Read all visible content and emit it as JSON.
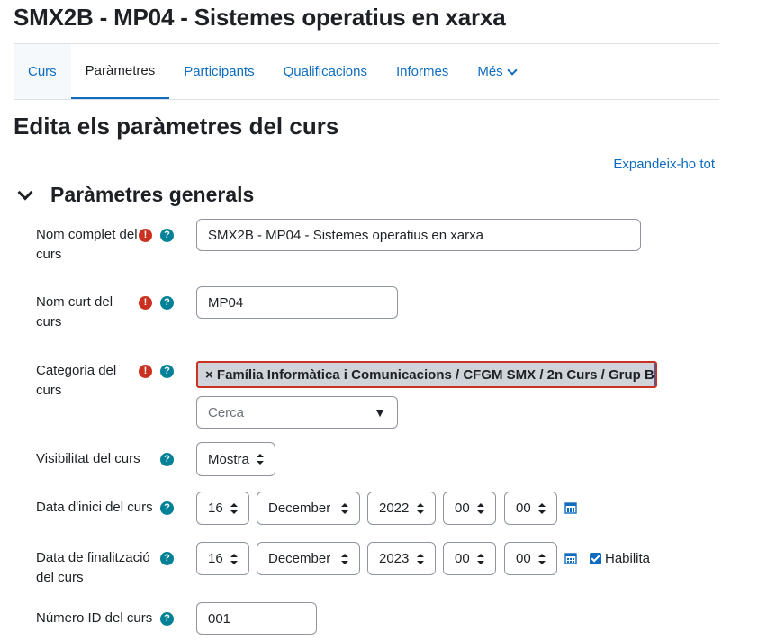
{
  "header": {
    "title": "SMX2B - MP04 - Sistemes operatius en xarxa"
  },
  "tabs": [
    {
      "label": "Curs"
    },
    {
      "label": "Paràmetres"
    },
    {
      "label": "Participants"
    },
    {
      "label": "Qualificacions"
    },
    {
      "label": "Informes"
    },
    {
      "label": "Més"
    }
  ],
  "page": {
    "heading": "Edita els paràmetres del curs",
    "expand_all": "Expandeix-ho tot",
    "section": "Paràmetres generals"
  },
  "form": {
    "fullname": {
      "label": "Nom complet del curs",
      "value": "SMX2B - MP04 - Sistemes operatius en xarxa"
    },
    "shortname": {
      "label": "Nom curt del curs",
      "value": "MP04"
    },
    "category": {
      "label": "Categoria del curs",
      "selected": "× Família Informàtica i Comunicacions / CFGM SMX / 2n Curs / Grup B",
      "search_placeholder": "Cerca"
    },
    "visibility": {
      "label": "Visibilitat del curs",
      "value": "Mostra"
    },
    "startdate": {
      "label": "Data d'inici del curs",
      "day": "16",
      "month": "December",
      "year": "2022",
      "hour": "00",
      "minute": "00"
    },
    "enddate": {
      "label": "Data de finalització del curs",
      "day": "16",
      "month": "December",
      "year": "2023",
      "hour": "00",
      "minute": "00",
      "enable_label": "Habilita"
    },
    "idnumber": {
      "label": "Número ID del curs",
      "value": "001"
    }
  },
  "colors": {
    "link": "#0f6cbf",
    "required": "#ca3120",
    "help": "#008196"
  }
}
